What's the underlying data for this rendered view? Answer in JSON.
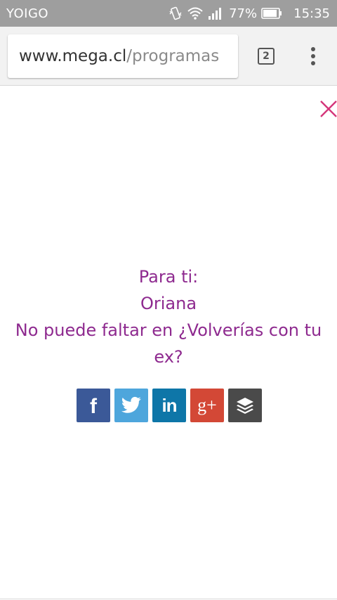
{
  "status_bar": {
    "carrier": "YOIGO",
    "battery_percent": "77%",
    "time": "15:35"
  },
  "browser": {
    "url_host": "www.mega.cl",
    "url_path": "/programas",
    "tab_count": "2"
  },
  "message": {
    "line1": "Para ti:",
    "line2": "Oriana",
    "line3": "No puede faltar en ¿Volverías con tu ex?"
  },
  "share": {
    "facebook_glyph": "f",
    "linkedin_glyph": "in",
    "googleplus_glyph": "g+",
    "colors": {
      "facebook": "#3b5998",
      "twitter": "#4ea6dc",
      "linkedin": "#0e76a8",
      "googleplus": "#d34836",
      "buffer": "#4a4a4a"
    }
  },
  "colors": {
    "status_bar": "#9e9e9e",
    "toolbar": "#f2f2f2",
    "message_text": "#8e2a8f",
    "close_icon": "#d4357a"
  }
}
